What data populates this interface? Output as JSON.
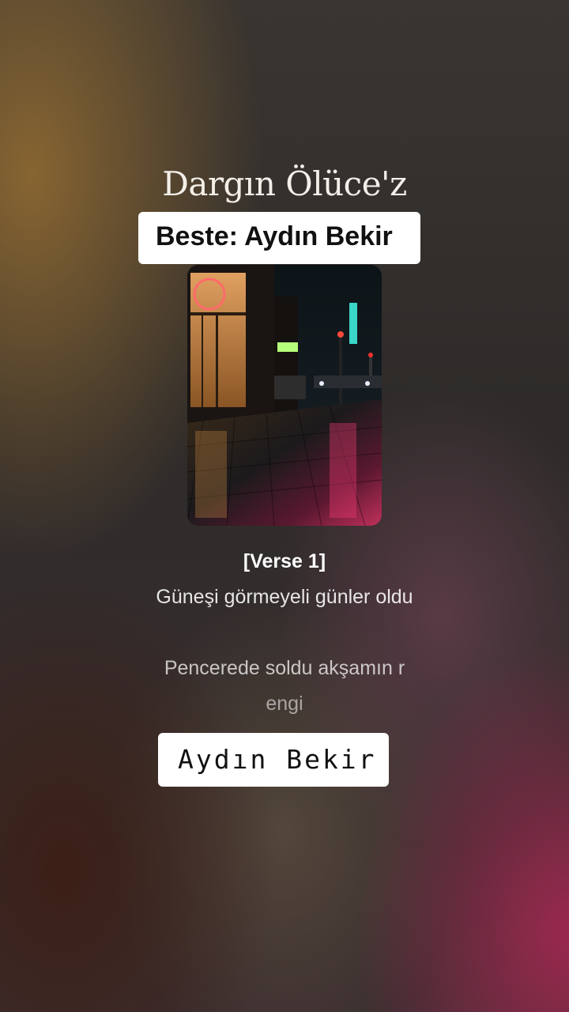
{
  "song": {
    "title": "Dargın Ölüce'z",
    "composer_label": "Beste: Aydın Bekir"
  },
  "cover": {
    "image": "night-street-neon-rain"
  },
  "lyrics": {
    "section": "[Verse 1]",
    "lines": [
      "Güneşi görmeyeli günler oldu",
      "Pencerede soldu akşamın r",
      "engi"
    ]
  },
  "artist": {
    "name": "Aydın Bekir"
  },
  "colors": {
    "background_warm": "#966e32",
    "background_magenta": "#a02850",
    "text": "#ffffff"
  }
}
